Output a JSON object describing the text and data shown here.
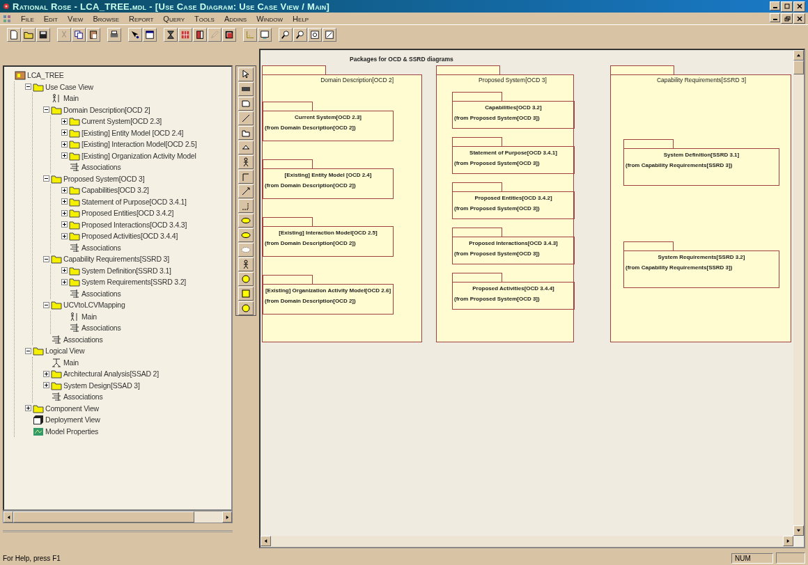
{
  "window": {
    "title": "Rational Rose - LCA_TREE.mdl - [Use Case Diagram: Use Case View / Main]"
  },
  "menu": [
    "File",
    "Edit",
    "View",
    "Browse",
    "Report",
    "Query",
    "Tools",
    "Addins",
    "Window",
    "Help"
  ],
  "browser": {
    "tree": [
      {
        "label": "LCA_TREE",
        "kind": "root",
        "children": [
          {
            "label": "Use Case View",
            "kind": "folder",
            "expanded": true,
            "children": [
              {
                "label": "Main",
                "kind": "usecase-diagram"
              },
              {
                "label": "Domain Description[OCD 2]",
                "kind": "folder",
                "expanded": true,
                "children": [
                  {
                    "label": "Current System[OCD 2.3]",
                    "kind": "folder",
                    "expanded": false
                  },
                  {
                    "label": "[Existing] Entity Model [OCD 2.4]",
                    "kind": "folder",
                    "expanded": false
                  },
                  {
                    "label": "[Existing] Interaction Model[OCD 2.5]",
                    "kind": "folder",
                    "expanded": false
                  },
                  {
                    "label": "[Existing] Organization Activity Model",
                    "kind": "folder",
                    "expanded": false
                  },
                  {
                    "label": "Associations",
                    "kind": "associations"
                  }
                ]
              },
              {
                "label": "Proposed System[OCD 3]",
                "kind": "folder",
                "expanded": true,
                "children": [
                  {
                    "label": "Capabilities[OCD 3.2]",
                    "kind": "folder",
                    "expanded": false
                  },
                  {
                    "label": "Statement of Purpose[OCD 3.4.1]",
                    "kind": "folder",
                    "expanded": false
                  },
                  {
                    "label": "Proposed Entities[OCD 3.4.2]",
                    "kind": "folder",
                    "expanded": false
                  },
                  {
                    "label": "Proposed Interactions[OCD 3.4.3]",
                    "kind": "folder",
                    "expanded": false
                  },
                  {
                    "label": "Proposed Activities[OCD 3.4.4]",
                    "kind": "folder",
                    "expanded": false
                  },
                  {
                    "label": "Associations",
                    "kind": "associations"
                  }
                ]
              },
              {
                "label": "Capability Requirements[SSRD 3]",
                "kind": "folder",
                "expanded": true,
                "children": [
                  {
                    "label": "System Definition[SSRD 3.1]",
                    "kind": "folder",
                    "expanded": false
                  },
                  {
                    "label": "System Requirements[SSRD 3.2]",
                    "kind": "folder",
                    "expanded": false
                  },
                  {
                    "label": "Associations",
                    "kind": "associations"
                  }
                ]
              },
              {
                "label": "UCVtoLCVMapping",
                "kind": "folder",
                "expanded": true,
                "children": [
                  {
                    "label": "Main",
                    "kind": "usecase-diagram"
                  },
                  {
                    "label": "Associations",
                    "kind": "associations"
                  }
                ]
              },
              {
                "label": "Associations",
                "kind": "associations"
              }
            ]
          },
          {
            "label": "Logical View",
            "kind": "folder",
            "expanded": true,
            "children": [
              {
                "label": "Main",
                "kind": "class-diagram"
              },
              {
                "label": "Architectural Analysis[SSAD 2]",
                "kind": "folder",
                "expanded": false
              },
              {
                "label": "System Design[SSAD 3]",
                "kind": "folder",
                "expanded": false
              },
              {
                "label": "Associations",
                "kind": "associations"
              }
            ]
          },
          {
            "label": "Component View",
            "kind": "folder",
            "expanded": false
          },
          {
            "label": "Deployment View",
            "kind": "deployment"
          },
          {
            "label": "Model Properties",
            "kind": "properties"
          }
        ]
      }
    ]
  },
  "diagram": {
    "title": "Packages for OCD & SSRD diagrams",
    "packages": [
      {
        "name": "Domain Description[OCD 2]",
        "children": [
          {
            "name": "Current System[OCD 2.3]",
            "from": "(from Domain Description[OCD 2])"
          },
          {
            "name": "[Existing] Entity Model [OCD 2.4]",
            "from": "(from Domain Description[OCD 2])"
          },
          {
            "name": "[Existing] Interaction Model[OCD 2.5]",
            "from": "(from Domain Description[OCD 2])"
          },
          {
            "name": "[Existing] Organization Activity Model[OCD 2.6]",
            "from": "(from Domain Description[OCD 2])"
          }
        ]
      },
      {
        "name": "Proposed System[OCD 3]",
        "children": [
          {
            "name": "Capabilities[OCD 3.2]",
            "from": "(from Proposed System[OCD 3])"
          },
          {
            "name": "Statement of Purpose[OCD 3.4.1]",
            "from": "(from Proposed System[OCD 3])"
          },
          {
            "name": "Proposed Entities[OCD 3.4.2]",
            "from": "(from Proposed System[OCD 3])"
          },
          {
            "name": "Proposed Interactions[OCD 3.4.3]",
            "from": "(from Proposed System[OCD 3])"
          },
          {
            "name": "Proposed Activities[OCD 3.4.4]",
            "from": "(from Proposed System[OCD 3])"
          }
        ]
      },
      {
        "name": "Capability Requirements[SSRD 3]",
        "children": [
          {
            "name": "System Definition[SSRD 3.1]",
            "from": "(from Capability Requirements[SSRD 3])"
          },
          {
            "name": "System Requirements[SSRD 3.2]",
            "from": "(from Capability Requirements[SSRD 3])"
          }
        ]
      }
    ]
  },
  "status_bar": {
    "message": "For Help, press F1",
    "indicator": "NUM"
  }
}
